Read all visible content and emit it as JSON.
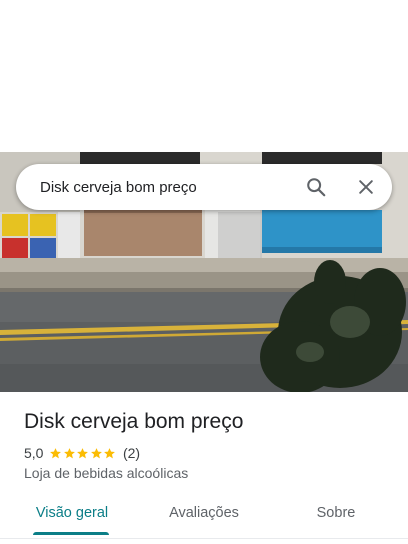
{
  "search": {
    "query": "Disk cerveja bom preço",
    "search_icon": "search-icon",
    "close_icon": "close-icon"
  },
  "place": {
    "name": "Disk cerveja bom preço",
    "rating": "5,0",
    "stars": 5,
    "review_count": "(2)",
    "category": "Loja de bebidas alcoólicas",
    "star_color": "#fbbc04"
  },
  "tabs": [
    {
      "label": "Visão geral",
      "active": true
    },
    {
      "label": "Avaliações",
      "active": false
    },
    {
      "label": "Sobre",
      "active": false
    }
  ],
  "colors": {
    "accent": "#0b7e87",
    "text_primary": "#202124",
    "text_secondary": "#5f6368"
  }
}
